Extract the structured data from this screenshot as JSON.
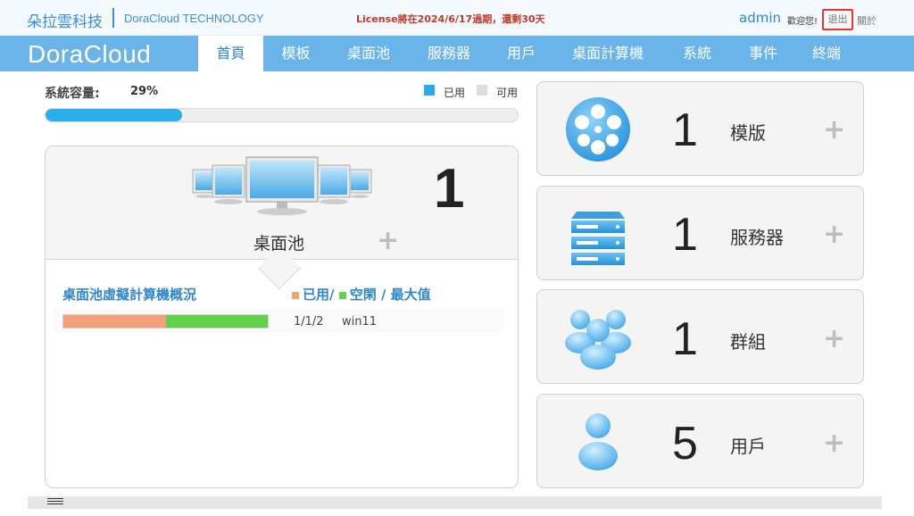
{
  "header": {
    "brand_cn": "朵拉雲科技",
    "brand_en": "DoraCloud TECHNOLOGY",
    "license": "License將在2024/6/17過期，還剩30天",
    "user": "admin",
    "welcome": "歡迎您!",
    "logout": "退出",
    "about": "關於"
  },
  "nav": {
    "logo": "DoraCloud",
    "items": [
      "首頁",
      "模板",
      "桌面池",
      "服務器",
      "用戶",
      "桌面計算機",
      "系統",
      "事件",
      "終端"
    ],
    "active_index": 0
  },
  "capacity": {
    "label": "系統容量:",
    "value": "29%",
    "percent": 29,
    "legend_used": "已用",
    "legend_free": "可用",
    "colors": {
      "used": "#29a8ea",
      "free": "#dcdcdc"
    }
  },
  "pool": {
    "count": "1",
    "title": "桌面池",
    "plus": "+",
    "vm_title": "桌面池虛擬計算機概況",
    "vm_legend": {
      "used": "已用/",
      "free": "空閑 / 最大值"
    },
    "rows": [
      {
        "ratio": "1/1/2",
        "name": "win11",
        "used": 1,
        "free": 1,
        "max": 2
      }
    ],
    "colors": {
      "used": "#f6a07a",
      "free": "#5fd24a"
    }
  },
  "stats": [
    {
      "count": "1",
      "label": "模版",
      "icon": "film-reel-icon"
    },
    {
      "count": "1",
      "label": "服務器",
      "icon": "server-icon"
    },
    {
      "count": "1",
      "label": "群組",
      "icon": "group-icon"
    },
    {
      "count": "5",
      "label": "用戶",
      "icon": "user-icon"
    }
  ],
  "stat_plus": "+",
  "accent": "#6ab4ea"
}
